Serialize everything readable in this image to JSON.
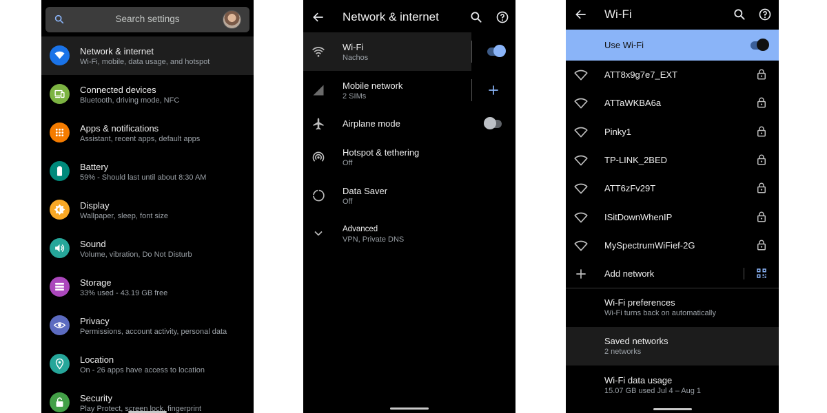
{
  "settings_screen": {
    "search_placeholder": "Search settings",
    "items": [
      {
        "title": "Network & internet",
        "subtitle": "Wi-Fi, mobile, data usage, and hotspot",
        "icon": "wifi-icon",
        "color": "#1a73e8"
      },
      {
        "title": "Connected devices",
        "subtitle": "Bluetooth, driving mode, NFC",
        "icon": "devices-icon",
        "color": "#7cb342"
      },
      {
        "title": "Apps & notifications",
        "subtitle": "Assistant, recent apps, default apps",
        "icon": "apps-icon",
        "color": "#f57c00"
      },
      {
        "title": "Battery",
        "subtitle": "59% - Should last until about 8:30 AM",
        "icon": "battery-icon",
        "color": "#00897b"
      },
      {
        "title": "Display",
        "subtitle": "Wallpaper, sleep, font size",
        "icon": "brightness-icon",
        "color": "#f9a825"
      },
      {
        "title": "Sound",
        "subtitle": "Volume, vibration, Do Not Disturb",
        "icon": "volume-icon",
        "color": "#26a69a"
      },
      {
        "title": "Storage",
        "subtitle": "33% used - 43.19 GB free",
        "icon": "storage-icon",
        "color": "#ab47bc"
      },
      {
        "title": "Privacy",
        "subtitle": "Permissions, account activity, personal data",
        "icon": "privacy-eye-icon",
        "color": "#5c6bc0"
      },
      {
        "title": "Location",
        "subtitle": "On - 26 apps have access to location",
        "icon": "location-pin-icon",
        "color": "#26a69a"
      },
      {
        "title": "Security",
        "subtitle": "Play Protect, screen lock, fingerprint",
        "icon": "lock-icon",
        "color": "#43a047"
      }
    ]
  },
  "network_screen": {
    "title": "Network & internet",
    "items": [
      {
        "title": "Wi-Fi",
        "subtitle": "Nachos",
        "icon": "wifi-icon",
        "toggle": "on"
      },
      {
        "title": "Mobile network",
        "subtitle": "2 SIMs",
        "icon": "signal-icon",
        "action": "add"
      },
      {
        "title": "Airplane mode",
        "subtitle": "",
        "icon": "airplane-icon",
        "toggle": "off"
      },
      {
        "title": "Hotspot & tethering",
        "subtitle": "Off",
        "icon": "hotspot-icon"
      },
      {
        "title": "Data Saver",
        "subtitle": "Off",
        "icon": "data-saver-icon"
      },
      {
        "title": "Advanced",
        "subtitle": "VPN, Private DNS",
        "icon": "chevron-down-icon"
      }
    ]
  },
  "wifi_screen": {
    "title": "Wi-Fi",
    "use_wifi_label": "Use Wi-Fi",
    "use_wifi_state": "on",
    "networks": [
      "ATT8x9g7e7_EXT",
      "ATTaWKBA6a",
      "Pinky1",
      "TP-LINK_2BED",
      "ATT6zFv29T",
      "ISitDownWhenIP",
      "MySpectrumWiFief-2G"
    ],
    "add_network_label": "Add network",
    "preferences": [
      {
        "title": "Wi-Fi preferences",
        "subtitle": "Wi-Fi turns back on automatically"
      },
      {
        "title": "Saved networks",
        "subtitle": "2 networks"
      },
      {
        "title": "Wi-Fi data usage",
        "subtitle": "15.07 GB used Jul 4 – Aug 1"
      }
    ]
  },
  "colors": {
    "accent": "#8ab4f8",
    "toggle_on_knob": "#8ab4f8",
    "toggle_on_track": "#3c5a86"
  }
}
